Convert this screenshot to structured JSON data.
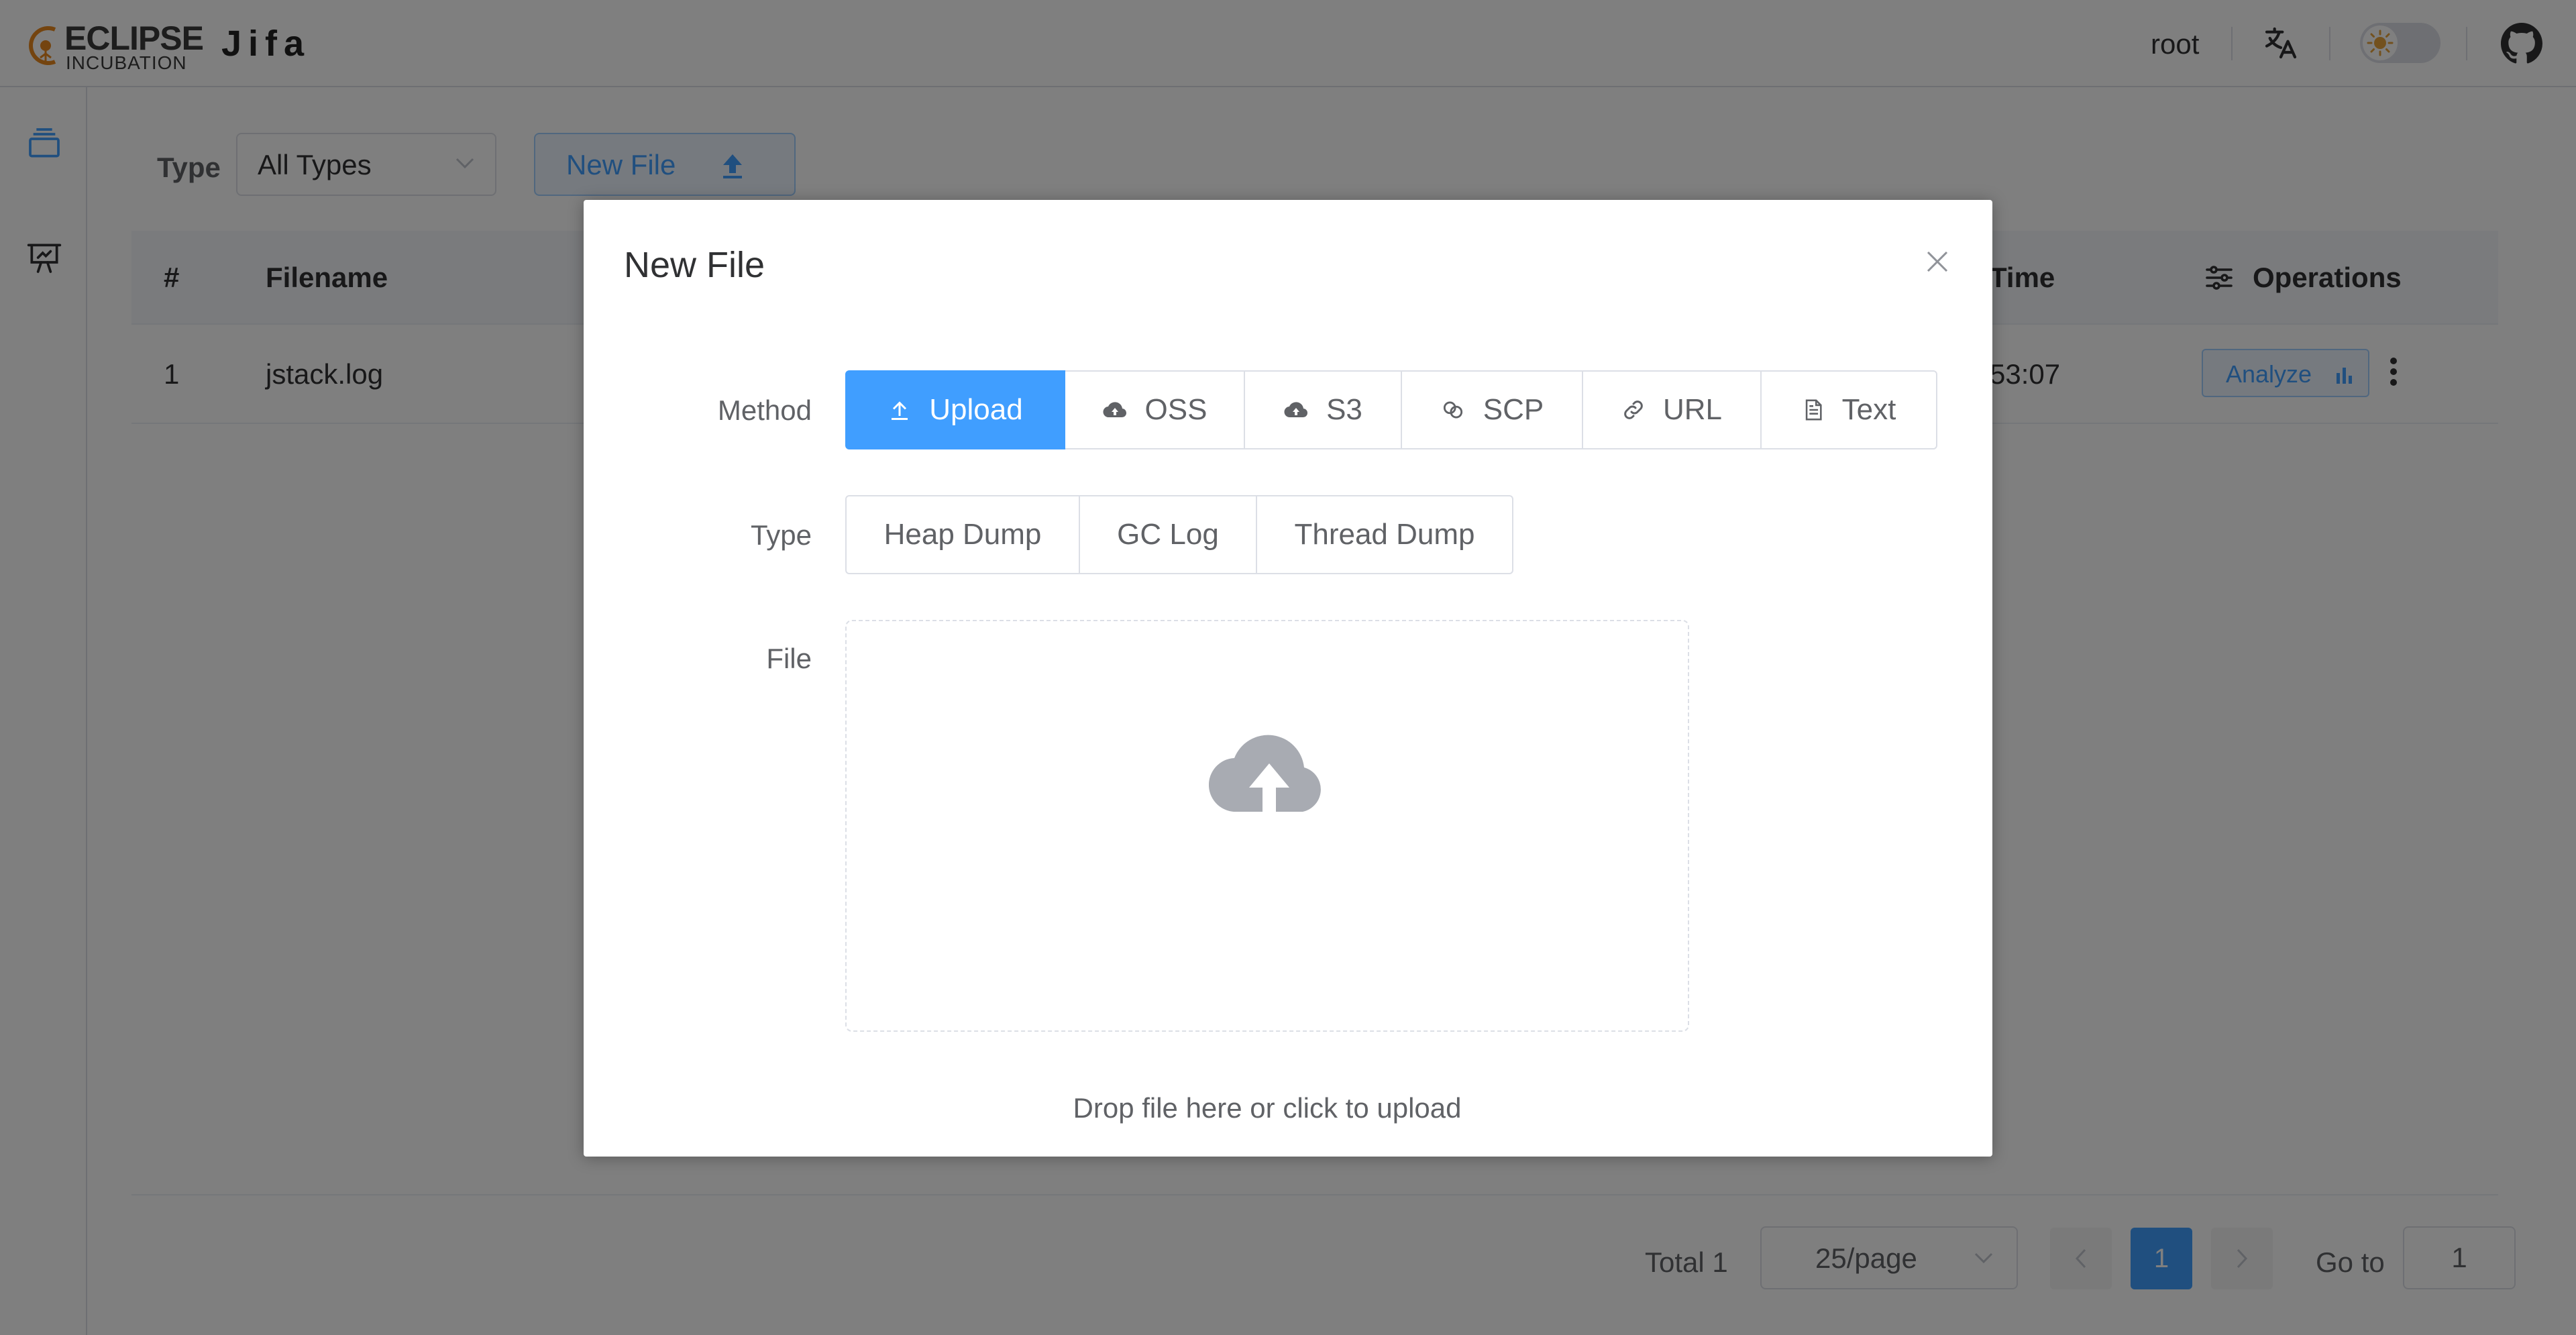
{
  "header": {
    "logo_line1": "ECLIPSE",
    "logo_line2": "INCUBATION",
    "app_title": "Jifa",
    "user": "root",
    "translate_icon": "translate-icon",
    "theme_toggle_icon": "sun-icon",
    "github_icon": "github-icon"
  },
  "sidebar": {
    "items": [
      {
        "icon": "files-icon"
      },
      {
        "icon": "presentation-icon"
      }
    ]
  },
  "toolbar": {
    "type_label": "Type",
    "type_value": "All Types",
    "new_file_label": "New File"
  },
  "table": {
    "columns": [
      "#",
      "Filename",
      "Time",
      "Operations"
    ],
    "rows": [
      {
        "index": "1",
        "filename": "jstack.log",
        "time": "53:07",
        "action": "Analyze"
      }
    ]
  },
  "pagination": {
    "total": "Total 1",
    "page_size": "25/page",
    "current_page": "1",
    "goto_label": "Go to",
    "goto_value": "1"
  },
  "dialog": {
    "title": "New File",
    "method_label": "Method",
    "methods": [
      "Upload",
      "OSS",
      "S3",
      "SCP",
      "URL",
      "Text"
    ],
    "selected_method": "Upload",
    "type_label": "Type",
    "types": [
      "Heap Dump",
      "GC Log",
      "Thread Dump"
    ],
    "file_label": "File",
    "drop_text": "Drop file here or click to upload"
  },
  "colors": {
    "primary": "#409eff",
    "overlay": "rgba(0,0,0,0.5)"
  }
}
